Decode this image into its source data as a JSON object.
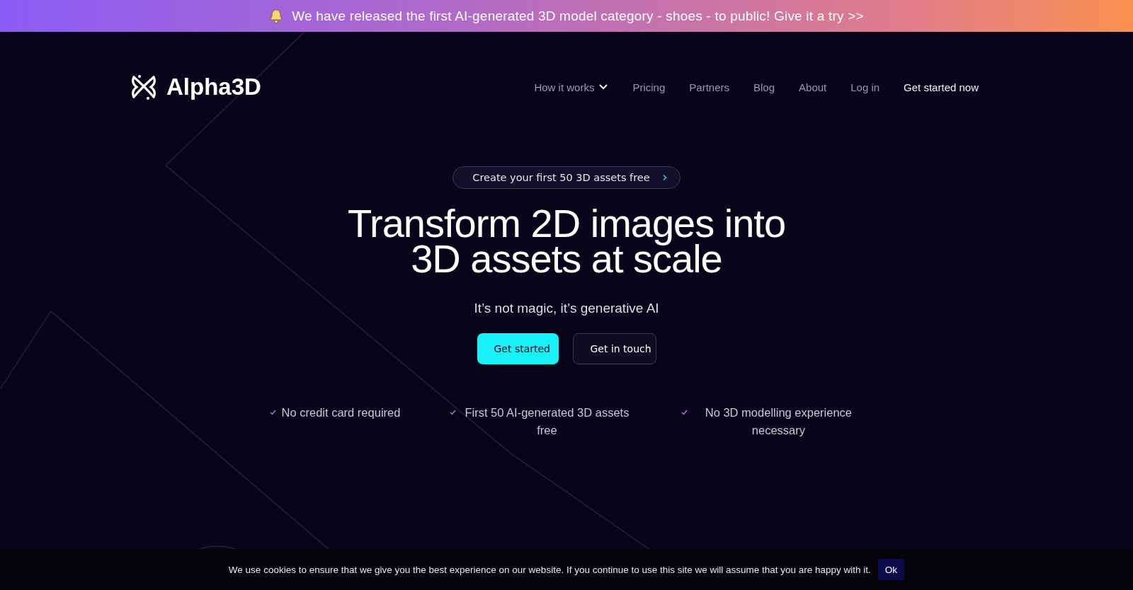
{
  "announcement": {
    "text": "We have released the first AI-generated 3D model category - shoes - to public! Give it a try >>"
  },
  "header": {
    "logo": "Alpha3D",
    "nav": [
      {
        "label": "How it works",
        "kind": "dropdown"
      },
      {
        "label": "Pricing",
        "kind": "link"
      },
      {
        "label": "Partners",
        "kind": "link"
      },
      {
        "label": "Blog",
        "kind": "link"
      },
      {
        "label": "About",
        "kind": "link"
      },
      {
        "label": "Log in",
        "kind": "link"
      },
      {
        "label": "Get started now",
        "kind": "cta"
      }
    ]
  },
  "hero": {
    "badge": "Create your first 50 3D assets free",
    "title_lines": [
      "Transform 2D images into",
      "3D assets at scale"
    ],
    "subtitle": "It’s not magic, it’s generative AI",
    "buttons": [
      {
        "label": "Get started",
        "kind": "primary"
      },
      {
        "label": "Get in touch",
        "kind": "secondary"
      }
    ],
    "features": [
      "No credit card required",
      "First 50 AI-generated 3D assets free",
      "No 3D modelling experience necessary"
    ]
  },
  "cookie_bar": {
    "text": "We use cookies to ensure that we give you the best experience on our website. If you continue to use this site we will assume that you are happy with it.",
    "button": "Ok"
  }
}
